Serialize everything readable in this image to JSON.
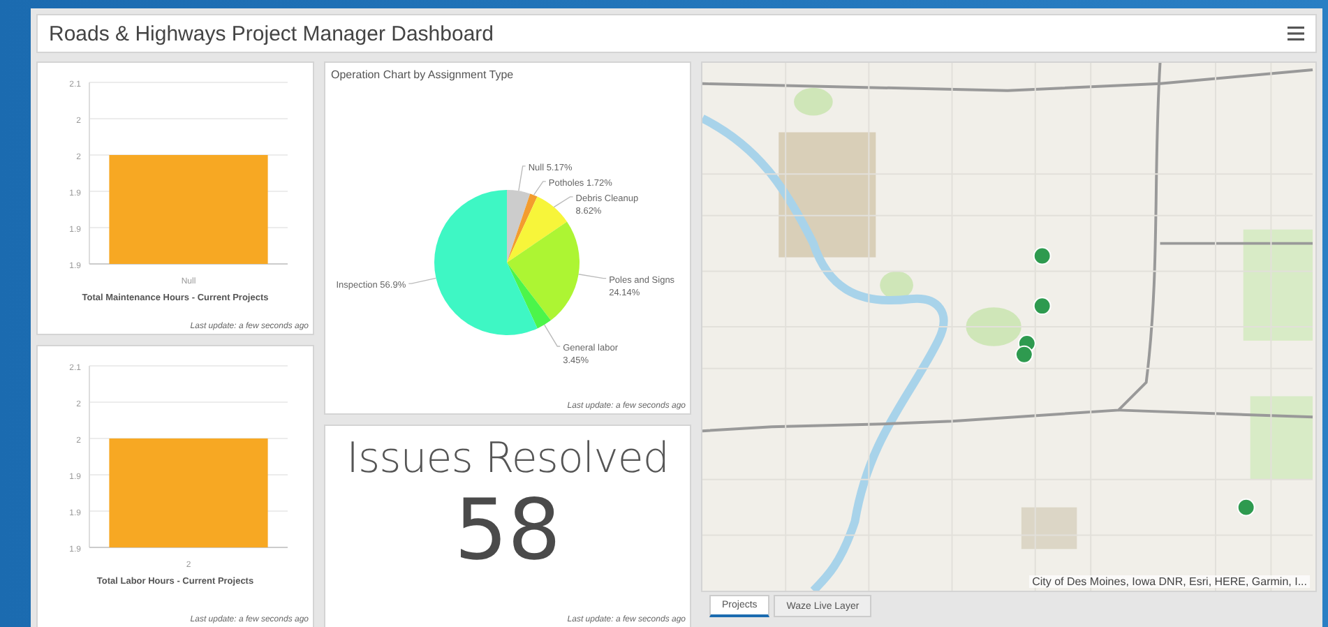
{
  "header": {
    "title": "Roads & Highways Project Manager Dashboard"
  },
  "bar_panels": [
    {
      "chart_data": {
        "type": "bar",
        "grid": true,
        "categories": [
          "Null"
        ],
        "ylim": [
          1.85,
          2.1
        ],
        "yticks": [
          {
            "value": 2.1,
            "label": "2.1"
          },
          {
            "value": 2.05,
            "label": "2"
          },
          {
            "value": 2.0,
            "label": "2"
          },
          {
            "value": 1.95,
            "label": "1.9"
          },
          {
            "value": 1.9,
            "label": "1.9"
          },
          {
            "value": 1.85,
            "label": "1.9"
          }
        ],
        "series": [
          {
            "color": "#f7a823",
            "values": [
              2.0
            ]
          }
        ]
      },
      "caption": "Total Maintenance Hours - Current Projects",
      "updated": "Last update: a few seconds ago"
    },
    {
      "chart_data": {
        "type": "bar",
        "grid": true,
        "categories": [
          "2"
        ],
        "ylim": [
          1.85,
          2.1
        ],
        "yticks": [
          {
            "value": 2.1,
            "label": "2.1"
          },
          {
            "value": 2.05,
            "label": "2"
          },
          {
            "value": 2.0,
            "label": "2"
          },
          {
            "value": 1.95,
            "label": "1.9"
          },
          {
            "value": 1.9,
            "label": "1.9"
          },
          {
            "value": 1.85,
            "label": "1.9"
          }
        ],
        "series": [
          {
            "color": "#f7a823",
            "values": [
              2.0
            ]
          }
        ]
      },
      "caption": "Total Labor Hours - Current Projects",
      "updated": "Last update: a few seconds ago"
    }
  ],
  "pie_panel": {
    "title": "Operation Chart by Assignment Type",
    "chart_data": {
      "type": "pie",
      "categories": [
        "Null",
        "Potholes",
        "Debris Cleanup",
        "Poles and Signs",
        "General labor",
        "Inspection"
      ],
      "series": [
        {
          "values": [
            5.17,
            1.72,
            8.62,
            24.14,
            3.45,
            56.9
          ]
        }
      ],
      "colors": [
        "#cccccc",
        "#f39c2e",
        "#f7f53a",
        "#adf533",
        "#4cf54a",
        "#3ef7c4"
      ],
      "value_labels": [
        "5.17%",
        "1.72%",
        "8.62%",
        "24.14%",
        "3.45%",
        "56.9%"
      ]
    },
    "label_wrap": [
      false,
      false,
      true,
      true,
      true,
      false
    ],
    "updated": "Last update: a few seconds ago"
  },
  "indicator": {
    "title": "Issues Resolved",
    "value": "58",
    "updated": "Last update: a few seconds ago"
  },
  "map": {
    "attribution": "City of Des Moines, Iowa DNR, Esri, HERE, Garmin, I...",
    "tabs": [
      {
        "label": "Projects",
        "selected": true
      },
      {
        "label": "Waze Live Layer",
        "selected": false
      }
    ]
  }
}
